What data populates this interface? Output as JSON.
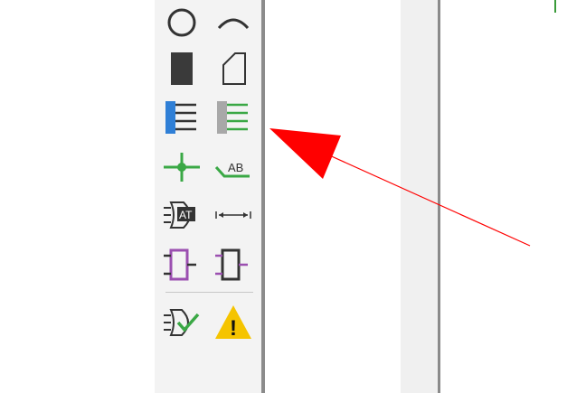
{
  "toolbar": {
    "tools": [
      {
        "name": "circle-tool",
        "icon": "circle-icon"
      },
      {
        "name": "arc-tool",
        "icon": "arc-icon"
      },
      {
        "name": "filled-rectangle-tool",
        "icon": "filled-rectangle-icon"
      },
      {
        "name": "polygon-tool",
        "icon": "polygon-icon"
      },
      {
        "name": "bus-entry-blue-tool",
        "icon": "bus-blue-icon"
      },
      {
        "name": "bus-entry-green-tool",
        "icon": "bus-green-icon"
      },
      {
        "name": "junction-tool",
        "icon": "junction-icon"
      },
      {
        "name": "net-label-tool",
        "icon": "net-label-icon",
        "text": "AB"
      },
      {
        "name": "attribute-tool",
        "icon": "attribute-gate-icon",
        "text": "AT"
      },
      {
        "name": "dimension-tool",
        "icon": "dimension-arrow-icon"
      },
      {
        "name": "pin-purple-tool",
        "icon": "component-purple-icon"
      },
      {
        "name": "pin-black-tool",
        "icon": "component-black-icon"
      },
      {
        "name": "check-gate-tool",
        "icon": "gate-check-icon"
      },
      {
        "name": "warning-tool",
        "icon": "warning-icon",
        "text": "!"
      }
    ]
  },
  "colors": {
    "accent_blue": "#2f7fd6",
    "accent_green": "#3aa845",
    "accent_purple": "#9b4fb0",
    "warning_yellow": "#f5c400",
    "arrow_red": "#ff0000"
  }
}
